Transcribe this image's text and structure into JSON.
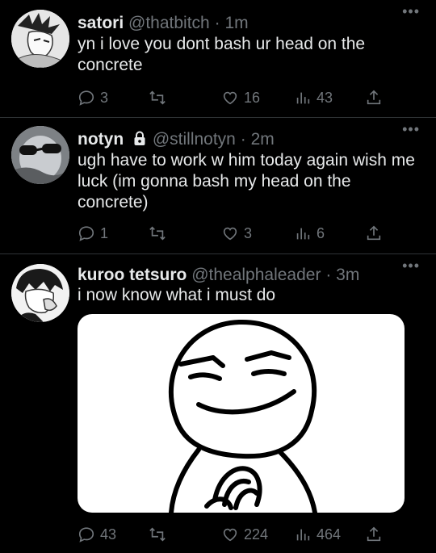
{
  "tweets": [
    {
      "name": "satori",
      "handle": "@thatbitch",
      "dot": "·",
      "time": "1m",
      "text": "yn i love you dont bash ur head on the concrete",
      "replies": "3",
      "likes": "16",
      "views": "43",
      "more": "•••"
    },
    {
      "name": "notyn",
      "handle": "@stillnotyn",
      "dot": "·",
      "time": "2m",
      "text": "ugh have to work w him today again wish me luck (im gonna bash my head on the concrete)",
      "replies": "1",
      "likes": "3",
      "views": "6",
      "more": "•••",
      "locked": true
    },
    {
      "name": "kuroo tetsuro",
      "handle": "@thealphaleader",
      "dot": "·",
      "time": "3m",
      "text": "i now know what i must do",
      "replies": "43",
      "likes": "224",
      "views": "464",
      "more": "•••"
    }
  ],
  "icons": [
    "reply-icon",
    "retweet-icon",
    "like-icon",
    "views-icon",
    "share-icon",
    "lock-icon",
    "more-icon"
  ],
  "colors": {
    "background": "#000000",
    "text": "#e7e9ea",
    "muted": "#71767b",
    "divider": "#2f3336"
  }
}
